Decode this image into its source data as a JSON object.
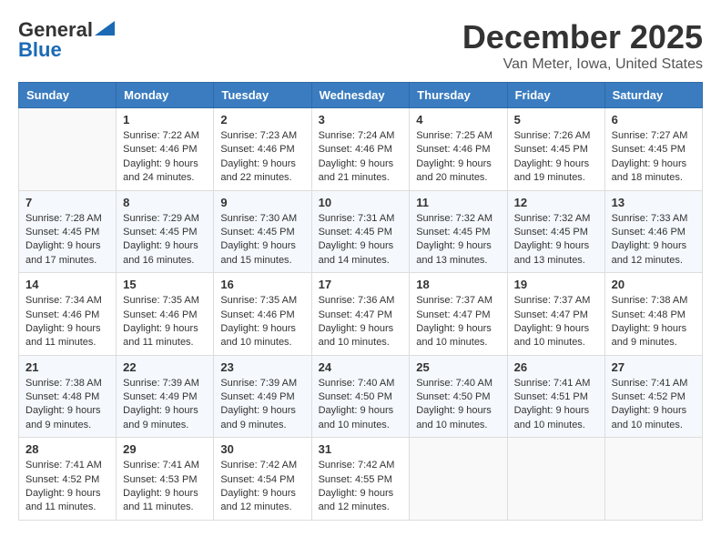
{
  "app": {
    "name": "GeneralBlue",
    "logo_line1": "General",
    "logo_line2": "Blue"
  },
  "calendar": {
    "month": "December 2025",
    "location": "Van Meter, Iowa, United States",
    "weekdays": [
      "Sunday",
      "Monday",
      "Tuesday",
      "Wednesday",
      "Thursday",
      "Friday",
      "Saturday"
    ],
    "weeks": [
      [
        {
          "day": "",
          "info": ""
        },
        {
          "day": "1",
          "info": "Sunrise: 7:22 AM\nSunset: 4:46 PM\nDaylight: 9 hours\nand 24 minutes."
        },
        {
          "day": "2",
          "info": "Sunrise: 7:23 AM\nSunset: 4:46 PM\nDaylight: 9 hours\nand 22 minutes."
        },
        {
          "day": "3",
          "info": "Sunrise: 7:24 AM\nSunset: 4:46 PM\nDaylight: 9 hours\nand 21 minutes."
        },
        {
          "day": "4",
          "info": "Sunrise: 7:25 AM\nSunset: 4:46 PM\nDaylight: 9 hours\nand 20 minutes."
        },
        {
          "day": "5",
          "info": "Sunrise: 7:26 AM\nSunset: 4:45 PM\nDaylight: 9 hours\nand 19 minutes."
        },
        {
          "day": "6",
          "info": "Sunrise: 7:27 AM\nSunset: 4:45 PM\nDaylight: 9 hours\nand 18 minutes."
        }
      ],
      [
        {
          "day": "7",
          "info": "Sunrise: 7:28 AM\nSunset: 4:45 PM\nDaylight: 9 hours\nand 17 minutes."
        },
        {
          "day": "8",
          "info": "Sunrise: 7:29 AM\nSunset: 4:45 PM\nDaylight: 9 hours\nand 16 minutes."
        },
        {
          "day": "9",
          "info": "Sunrise: 7:30 AM\nSunset: 4:45 PM\nDaylight: 9 hours\nand 15 minutes."
        },
        {
          "day": "10",
          "info": "Sunrise: 7:31 AM\nSunset: 4:45 PM\nDaylight: 9 hours\nand 14 minutes."
        },
        {
          "day": "11",
          "info": "Sunrise: 7:32 AM\nSunset: 4:45 PM\nDaylight: 9 hours\nand 13 minutes."
        },
        {
          "day": "12",
          "info": "Sunrise: 7:32 AM\nSunset: 4:45 PM\nDaylight: 9 hours\nand 13 minutes."
        },
        {
          "day": "13",
          "info": "Sunrise: 7:33 AM\nSunset: 4:46 PM\nDaylight: 9 hours\nand 12 minutes."
        }
      ],
      [
        {
          "day": "14",
          "info": "Sunrise: 7:34 AM\nSunset: 4:46 PM\nDaylight: 9 hours\nand 11 minutes."
        },
        {
          "day": "15",
          "info": "Sunrise: 7:35 AM\nSunset: 4:46 PM\nDaylight: 9 hours\nand 11 minutes."
        },
        {
          "day": "16",
          "info": "Sunrise: 7:35 AM\nSunset: 4:46 PM\nDaylight: 9 hours\nand 10 minutes."
        },
        {
          "day": "17",
          "info": "Sunrise: 7:36 AM\nSunset: 4:47 PM\nDaylight: 9 hours\nand 10 minutes."
        },
        {
          "day": "18",
          "info": "Sunrise: 7:37 AM\nSunset: 4:47 PM\nDaylight: 9 hours\nand 10 minutes."
        },
        {
          "day": "19",
          "info": "Sunrise: 7:37 AM\nSunset: 4:47 PM\nDaylight: 9 hours\nand 10 minutes."
        },
        {
          "day": "20",
          "info": "Sunrise: 7:38 AM\nSunset: 4:48 PM\nDaylight: 9 hours\nand 9 minutes."
        }
      ],
      [
        {
          "day": "21",
          "info": "Sunrise: 7:38 AM\nSunset: 4:48 PM\nDaylight: 9 hours\nand 9 minutes."
        },
        {
          "day": "22",
          "info": "Sunrise: 7:39 AM\nSunset: 4:49 PM\nDaylight: 9 hours\nand 9 minutes."
        },
        {
          "day": "23",
          "info": "Sunrise: 7:39 AM\nSunset: 4:49 PM\nDaylight: 9 hours\nand 9 minutes."
        },
        {
          "day": "24",
          "info": "Sunrise: 7:40 AM\nSunset: 4:50 PM\nDaylight: 9 hours\nand 10 minutes."
        },
        {
          "day": "25",
          "info": "Sunrise: 7:40 AM\nSunset: 4:50 PM\nDaylight: 9 hours\nand 10 minutes."
        },
        {
          "day": "26",
          "info": "Sunrise: 7:41 AM\nSunset: 4:51 PM\nDaylight: 9 hours\nand 10 minutes."
        },
        {
          "day": "27",
          "info": "Sunrise: 7:41 AM\nSunset: 4:52 PM\nDaylight: 9 hours\nand 10 minutes."
        }
      ],
      [
        {
          "day": "28",
          "info": "Sunrise: 7:41 AM\nSunset: 4:52 PM\nDaylight: 9 hours\nand 11 minutes."
        },
        {
          "day": "29",
          "info": "Sunrise: 7:41 AM\nSunset: 4:53 PM\nDaylight: 9 hours\nand 11 minutes."
        },
        {
          "day": "30",
          "info": "Sunrise: 7:42 AM\nSunset: 4:54 PM\nDaylight: 9 hours\nand 12 minutes."
        },
        {
          "day": "31",
          "info": "Sunrise: 7:42 AM\nSunset: 4:55 PM\nDaylight: 9 hours\nand 12 minutes."
        },
        {
          "day": "",
          "info": ""
        },
        {
          "day": "",
          "info": ""
        },
        {
          "day": "",
          "info": ""
        }
      ]
    ]
  }
}
